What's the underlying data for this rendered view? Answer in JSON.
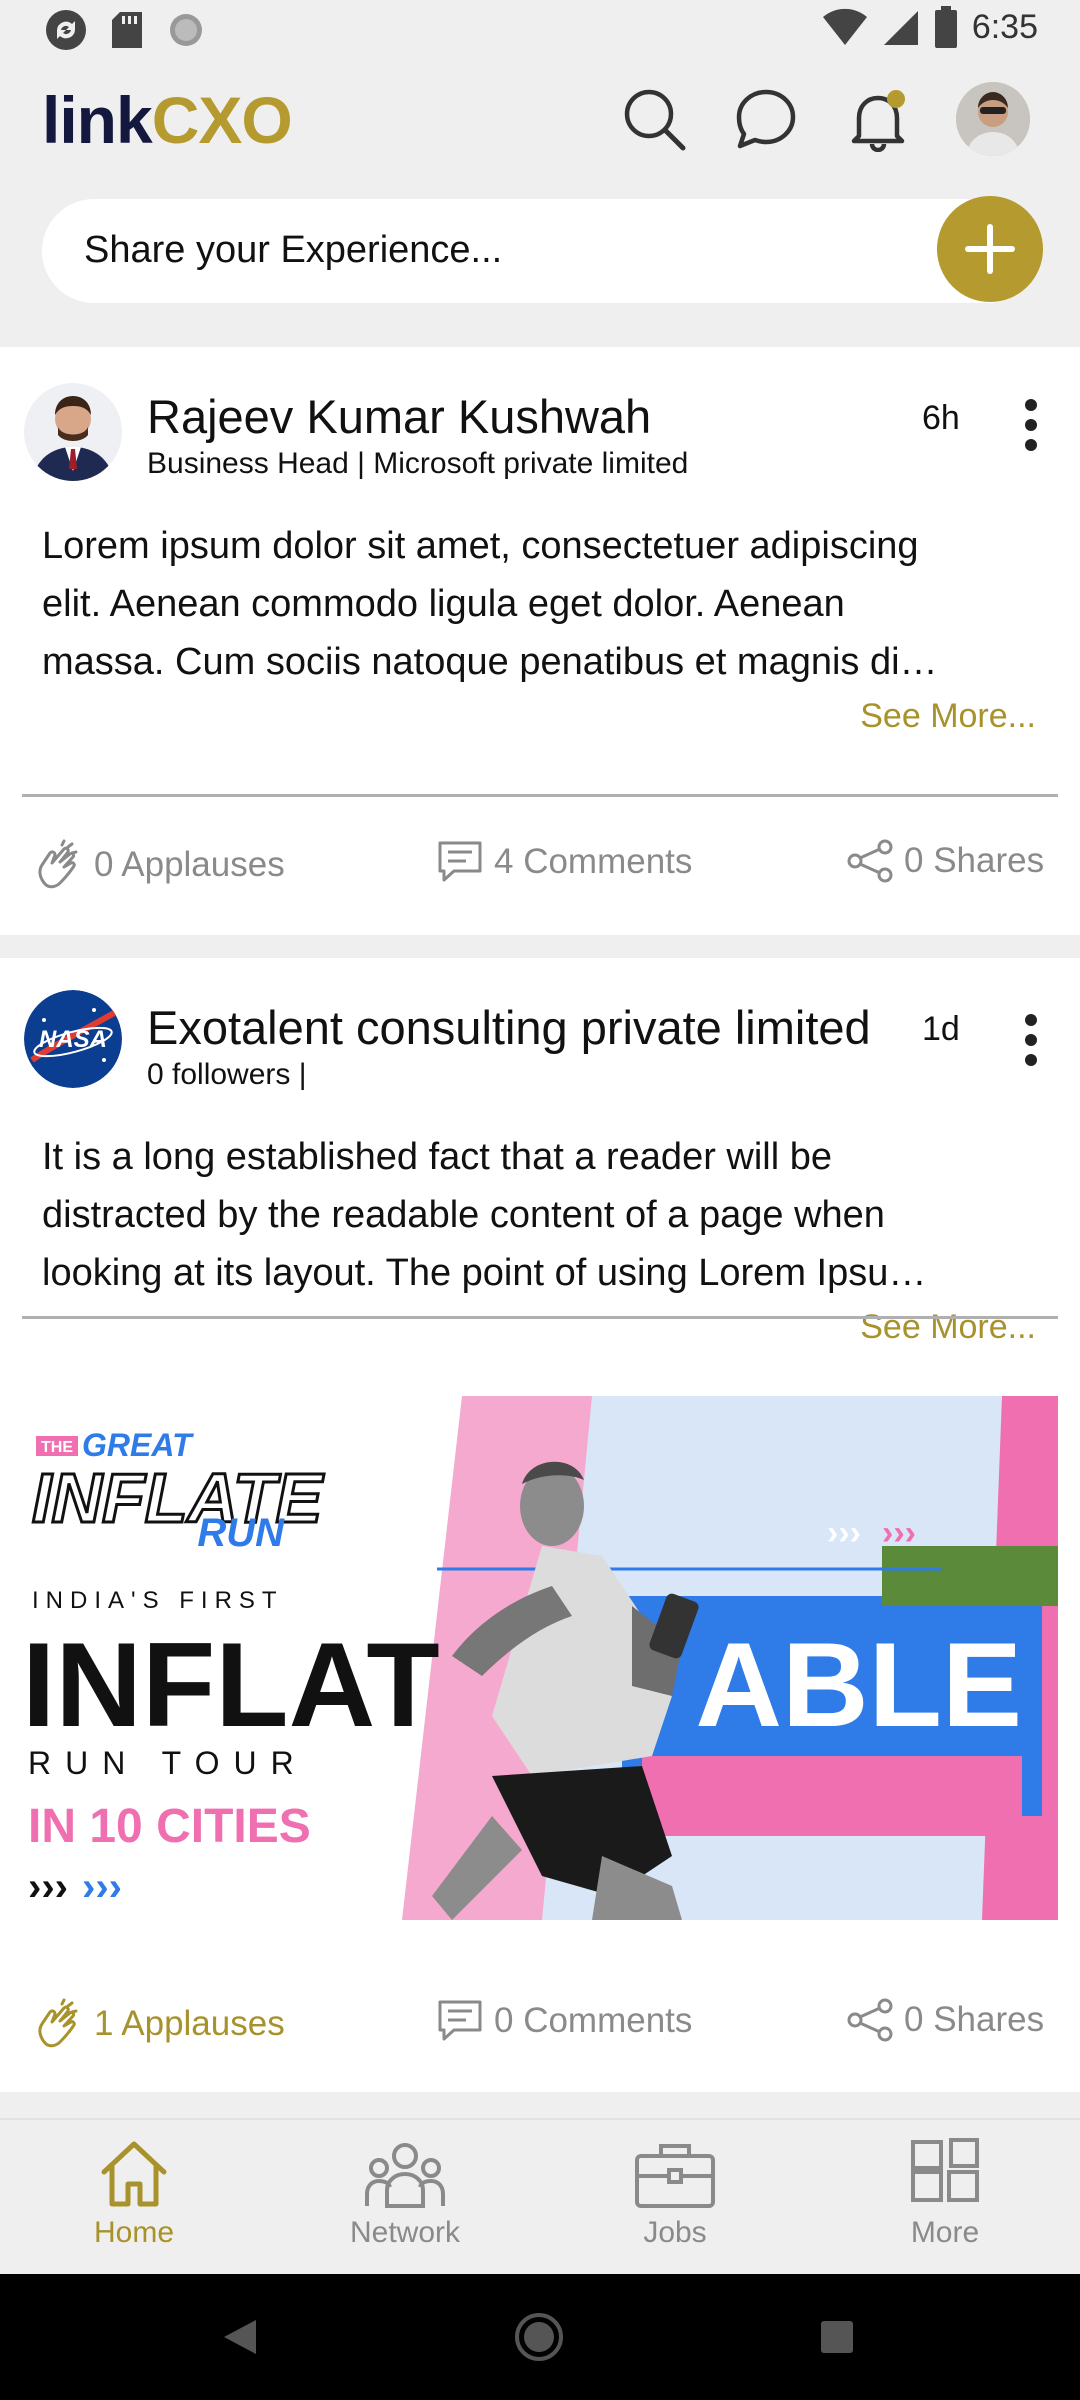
{
  "status_bar": {
    "time": "6:35",
    "icons": [
      "sync-icon",
      "sd-card-icon",
      "circle-icon",
      "wifi-icon",
      "signal-icon",
      "battery-icon"
    ]
  },
  "header": {
    "logo_link": "link",
    "logo_cxo": "CXO",
    "icons": [
      "search-icon",
      "chat-icon",
      "bell-icon",
      "profile-avatar"
    ]
  },
  "composer": {
    "placeholder": "Share your Experience...",
    "plus_icon": "plus-icon"
  },
  "posts": [
    {
      "author": "Rajeev  Kumar Kushwah",
      "subtitle": "Business Head | Microsoft private limited",
      "time": "6h",
      "body_lines": [
        "Lorem ipsum dolor sit amet, consectetuer adipiscing",
        "elit. Aenean commodo ligula eget dolor. Aenean",
        "massa. Cum sociis natoque penatibus et magnis di…"
      ],
      "see_more": "See More...",
      "applauses": "0 Applauses",
      "comments": "4 Comments",
      "shares": "0 Shares",
      "applause_active": false
    },
    {
      "author": "Exotalent consulting private limited",
      "subtitle": "0 followers |",
      "time": "1d",
      "body_lines": [
        "It is a long established fact that a reader will be",
        "distracted by the readable content of a page when",
        "looking at its layout. The point of using Lorem Ipsu…"
      ],
      "see_more": "See More...",
      "avatar_text": "NASA",
      "banner": {
        "tag": "THE",
        "great": "GREAT",
        "inflate": "INFLATE",
        "run": "RUN",
        "line1": "INDIA'S FIRST",
        "big_left": "INFLAT",
        "big_right": "ABLE",
        "line2": "RUN TOUR",
        "cities": "IN 10 CITIES",
        "arrows": "›››"
      },
      "applauses": "1 Applauses",
      "comments": "0 Comments",
      "shares": "0 Shares",
      "applause_active": true
    }
  ],
  "bottom_nav": [
    {
      "label": "Home",
      "icon": "home-icon",
      "active": true
    },
    {
      "label": "Network",
      "icon": "network-icon",
      "active": false
    },
    {
      "label": "Jobs",
      "icon": "briefcase-icon",
      "active": false
    },
    {
      "label": "More",
      "icon": "grid-icon",
      "active": false
    }
  ],
  "colors": {
    "accent": "#b59a2f",
    "brand_navy": "#14183f",
    "muted": "#8a8a8a",
    "pink": "#f06fb0",
    "blue": "#2f7be8"
  }
}
